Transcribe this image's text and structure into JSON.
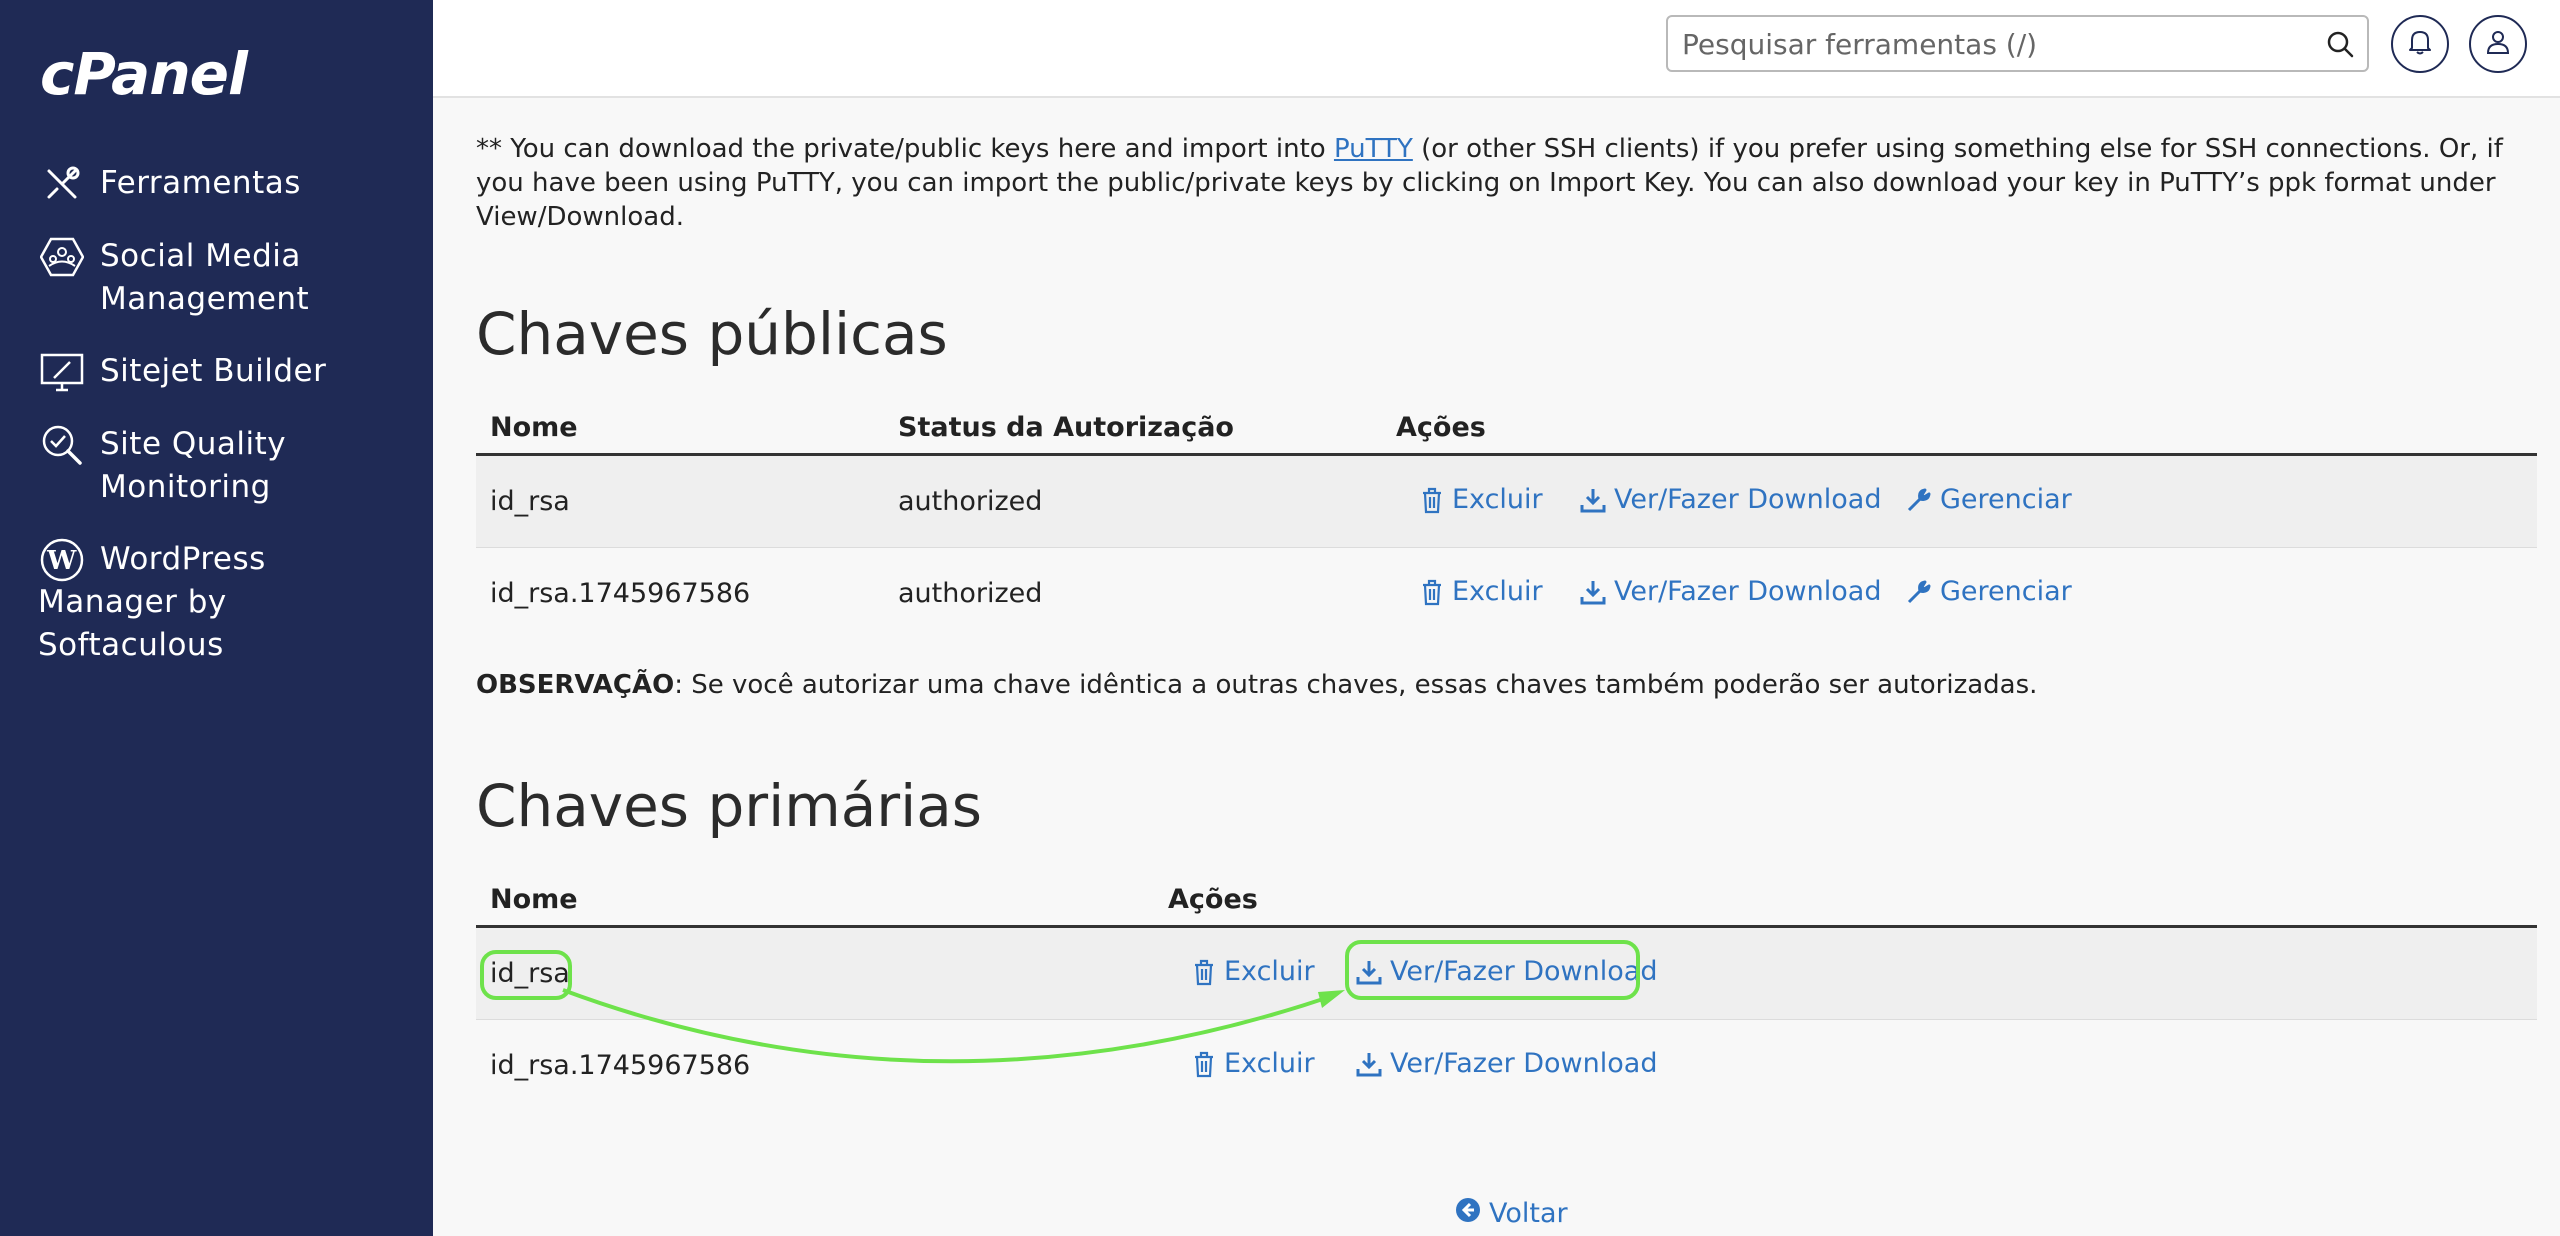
{
  "sidebar": {
    "logo": "cPanel",
    "items": [
      {
        "label": "Ferramentas",
        "icon": "tools-icon"
      },
      {
        "label": "Social Media\nManagement",
        "icon": "social-media-icon"
      },
      {
        "label": "Sitejet Builder",
        "icon": "sitejet-icon"
      },
      {
        "label": "Site Quality\nMonitoring",
        "icon": "site-quality-icon"
      },
      {
        "label": "WordPress\nManager by\nSoftaculous",
        "icon": "wordpress-icon"
      }
    ]
  },
  "topbar": {
    "search_placeholder": "Pesquisar ferramentas (/)",
    "search_value": ""
  },
  "intro": {
    "text_before_link": "** You can download the private/public keys here and import into ",
    "link_text": "PuTTY",
    "text_after_link": " (or other SSH clients) if you prefer using something else for SSH connections. Or, if you have been using PuTTY, you can import the public/private keys by clicking on Import Key. You can also download your key in PuTTY’s ppk format under View/Download."
  },
  "public_keys": {
    "title": "Chaves públicas",
    "headers": {
      "name": "Nome",
      "status": "Status da Autorização",
      "actions": "Ações"
    },
    "rows": [
      {
        "name": "id_rsa",
        "status": "authorized"
      },
      {
        "name": "id_rsa.1745967586",
        "status": "authorized"
      }
    ],
    "actions": {
      "delete": "Excluir",
      "download": "Ver/Fazer Download",
      "manage": "Gerenciar"
    }
  },
  "note": {
    "label": "OBSERVAÇÃO",
    "text": ": Se você autorizar uma chave idêntica a outras chaves, essas chaves também poderão ser autorizadas."
  },
  "private_keys": {
    "title": "Chaves primárias",
    "headers": {
      "name": "Nome",
      "actions": "Ações"
    },
    "rows": [
      {
        "name": "id_rsa"
      },
      {
        "name": "id_rsa.1745967586"
      }
    ],
    "actions": {
      "delete": "Excluir",
      "download": "Ver/Fazer Download"
    }
  },
  "back_link": "Voltar",
  "colors": {
    "sidebar_bg": "#1f2a55",
    "link": "#2f73c1",
    "annotation": "#6ee24b"
  }
}
